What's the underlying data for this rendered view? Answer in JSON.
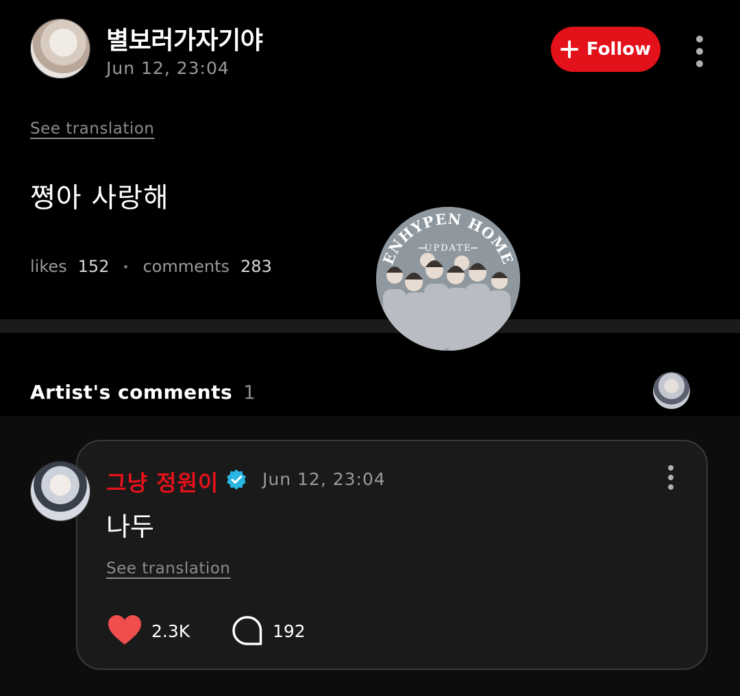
{
  "post": {
    "author": "별보러가자기야",
    "date": "Jun 12, 23:04",
    "follow_label": "Follow",
    "see_translation": "See translation",
    "body": "쪙아 사랑해",
    "likes_label": "likes",
    "likes_count": "152",
    "comments_label": "comments",
    "comments_count": "283"
  },
  "watermark": {
    "line1": "ENHYPEN HOME",
    "line2": "UPDATE"
  },
  "artist_section": {
    "title": "Artist's comments",
    "count": "1"
  },
  "comment": {
    "author": "그냥 정원이",
    "date": "Jun 12, 23:04",
    "body": "나두",
    "see_translation": "See translation",
    "likes": "2.3K",
    "replies": "192"
  },
  "colors": {
    "accent_red": "#e3121a",
    "verified_blue": "#29b6e3",
    "heart_red": "#f04e4e"
  },
  "icons": {
    "follow": "plus-icon",
    "menu": "more-vertical-icon",
    "verified": "verified-badge-icon",
    "like": "heart-icon",
    "reply": "speech-bubble-icon"
  }
}
